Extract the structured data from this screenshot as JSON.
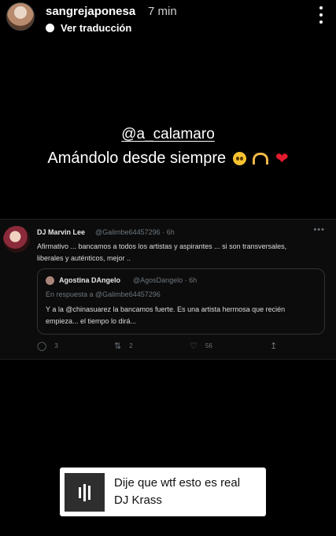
{
  "header": {
    "username": "sangrejaponesa",
    "time": "7 min",
    "translate_label": "Ver traducción",
    "more_icon": "kebab-icon"
  },
  "story": {
    "mention": "@a_calamaro",
    "caption": "Amándolo desde siempre",
    "emojis": [
      "pleading-face",
      "heart-hands",
      "red-heart"
    ]
  },
  "tweet": {
    "author": "DJ Marvin Lee",
    "meta": "@Galimbe64457296 · 6h",
    "text": "Afirmativo ... bancamos a todos los artistas y aspirantes ...  si son transversales, liberales y auténticos, mejor ..",
    "quote": {
      "author": "Agostina DAngelo",
      "meta": "@AgosDangelo · 6h",
      "reply_to": "En respuesta a @Galimbe64457296",
      "text": "Y a la @chinasuarez la bancamos fuerte. Es una artista hermosa que recién empieza... el tiempo lo dirá..."
    },
    "actions": {
      "replies": "3",
      "retweets": "2",
      "likes": "56"
    }
  },
  "music": {
    "title": "Dije que wtf esto es real",
    "artist": "DJ Krass"
  }
}
